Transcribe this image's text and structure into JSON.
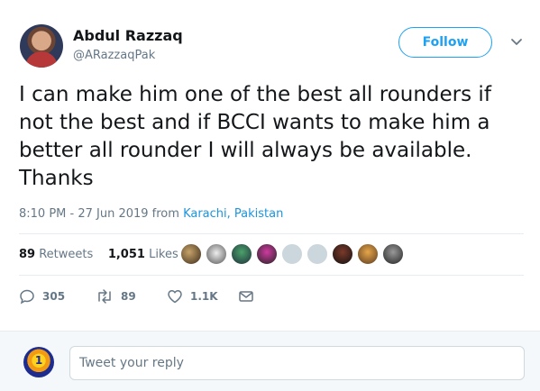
{
  "author": {
    "name": "Abdul Razzaq",
    "handle": "@ARazzaqPak",
    "avatar_icon": "user-avatar"
  },
  "header": {
    "follow_label": "Follow",
    "more_icon": "chevron-down-icon"
  },
  "tweet": {
    "text": "I can make him one of the best all rounders if not the best and if BCCI wants to make him a better all rounder I will always be available. Thanks",
    "timestamp": "8:10 PM - 27 Jun 2019 from ",
    "location": "Karachi, Pakistan"
  },
  "stats": {
    "retweets_count": "89",
    "retweets_label": "Retweets",
    "likes_count": "1,051",
    "likes_label": "Likes"
  },
  "actions": {
    "reply_count": "305",
    "retweet_count": "89",
    "like_count": "1.1K"
  },
  "reply_box": {
    "placeholder": "Tweet your reply",
    "avatar_text": "1"
  },
  "colors": {
    "accent": "#1da1f2",
    "link": "#1b95e0",
    "muted": "#657786"
  }
}
